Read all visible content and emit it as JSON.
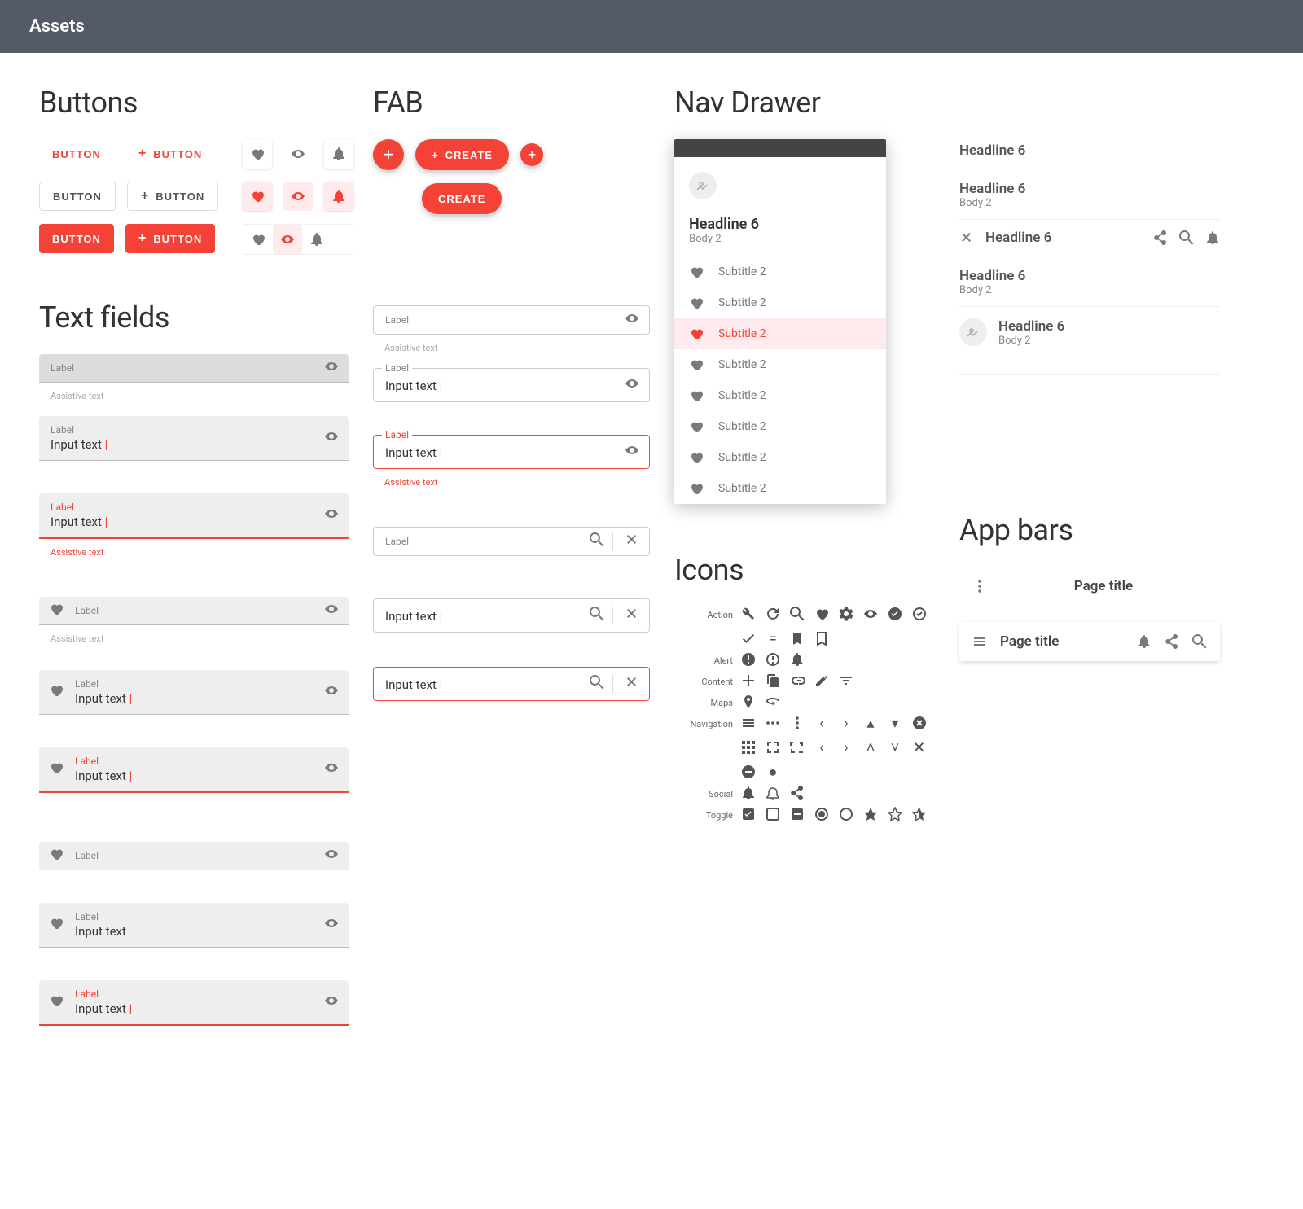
{
  "topbar": {
    "title": "Assets"
  },
  "sections": {
    "buttons": "Buttons",
    "fab": "FAB",
    "nav_drawer": "Nav Drawer",
    "text_fields": "Text fields",
    "icons": "Icons",
    "app_bars": "App bars"
  },
  "buttons": {
    "label": "BUTTON"
  },
  "fab": {
    "create": "CREATE"
  },
  "drawer": {
    "headline": "Headline 6",
    "body": "Body 2",
    "items": [
      {
        "label": "Subtitle 2",
        "active": false
      },
      {
        "label": "Subtitle 2",
        "active": false
      },
      {
        "label": "Subtitle 2",
        "active": true
      },
      {
        "label": "Subtitle 2",
        "active": false
      },
      {
        "label": "Subtitle 2",
        "active": false
      },
      {
        "label": "Subtitle 2",
        "active": false
      },
      {
        "label": "Subtitle 2",
        "active": false
      },
      {
        "label": "Subtitle 2",
        "active": false
      }
    ]
  },
  "headlines": {
    "h6": "Headline 6",
    "body2": "Body 2"
  },
  "textfields": {
    "label": "Label",
    "input": "Input text",
    "assist": "Assistive text"
  },
  "icon_categories": [
    "Action",
    "Alert",
    "Content",
    "Maps",
    "Navigation",
    "Social",
    "Toggle"
  ],
  "appbars": {
    "page_title": "Page title"
  },
  "colors": {
    "primary": "#f44336",
    "grey": "#7a7a7a"
  }
}
